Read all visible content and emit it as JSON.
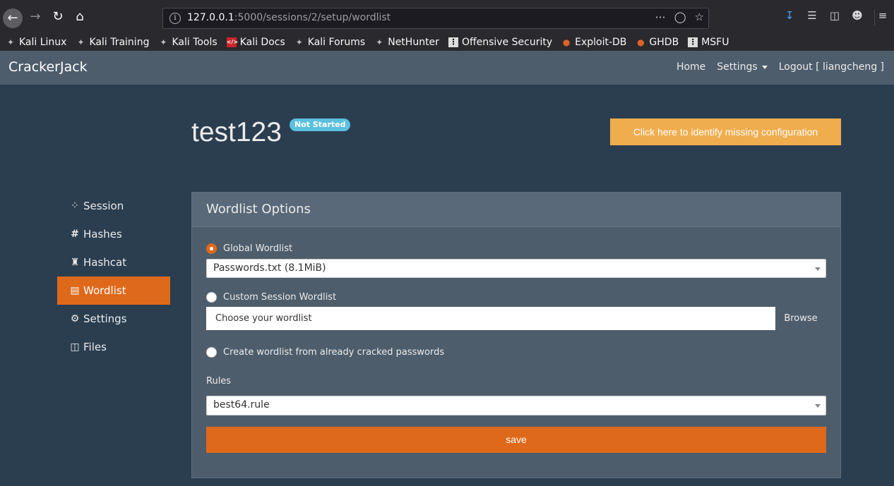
{
  "browser": {
    "url_host": "127.0.0.1",
    "url_path": ":5000/sessions/2/setup/wordlist"
  },
  "bookmarks": [
    {
      "label": "Kali Linux",
      "icon": "kali-dragon-icon"
    },
    {
      "label": "Kali Training",
      "icon": "kali-dragon-icon"
    },
    {
      "label": "Kali Tools",
      "icon": "kali-dragon-icon"
    },
    {
      "label": "Kali Docs",
      "icon": "kali-docs-icon"
    },
    {
      "label": "Kali Forums",
      "icon": "kali-dragon-icon"
    },
    {
      "label": "NetHunter",
      "icon": "nethunter-icon"
    },
    {
      "label": "Offensive Security",
      "icon": "offsec-icon"
    },
    {
      "label": "Exploit-DB",
      "icon": "exploitdb-icon"
    },
    {
      "label": "GHDB",
      "icon": "exploitdb-icon"
    },
    {
      "label": "MSFU",
      "icon": "offsec-icon"
    }
  ],
  "navbar": {
    "brand": "CrackerJack",
    "home": "Home",
    "settings": "Settings",
    "logout": "Logout [ liangcheng ]"
  },
  "header": {
    "title": "test123",
    "status": "Not Started",
    "missing_config": "Click here to identify missing configuration"
  },
  "sidebar": {
    "items": [
      {
        "label": "Session",
        "icon": "spinner-icon"
      },
      {
        "label": "Hashes",
        "icon": "hash-icon"
      },
      {
        "label": "Hashcat",
        "icon": "cat-icon"
      },
      {
        "label": "Wordlist",
        "icon": "file-icon",
        "active": true
      },
      {
        "label": "Settings",
        "icon": "gear-icon"
      },
      {
        "label": "Files",
        "icon": "folder-icon"
      }
    ]
  },
  "panel": {
    "title": "Wordlist Options",
    "global_label": "Global Wordlist",
    "global_value": "Passwords.txt (8.1MiB)",
    "custom_label": "Custom Session Wordlist",
    "file_placeholder": "Choose your wordlist",
    "browse": "Browse",
    "cracked_label": "Create wordlist from already cracked passwords",
    "rules_label": "Rules",
    "rules_value": "best64.rule",
    "save": "save"
  },
  "colors": {
    "primary": "#df691a",
    "warning": "#f0ad4e",
    "info": "#5bc0de",
    "background": "#2b3e50"
  }
}
